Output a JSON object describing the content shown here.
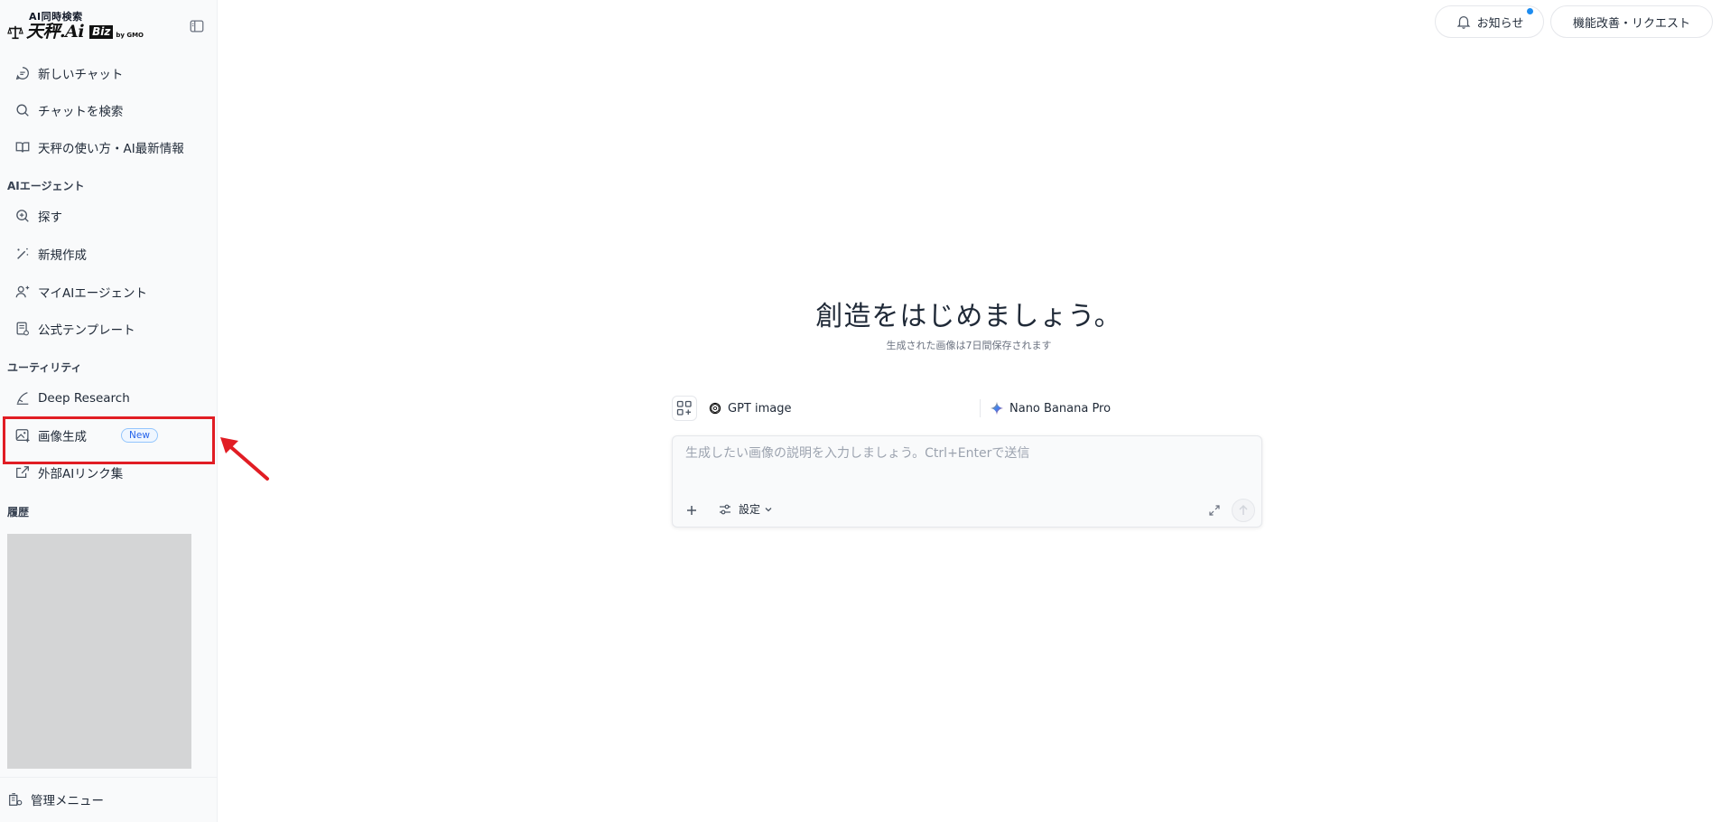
{
  "logo": {
    "subtitle": "AI同時検索",
    "brand": "天秤.Ai",
    "biz": "Biz",
    "by": "by GMO"
  },
  "sidebar": {
    "top_items": [
      {
        "label": "新しいチャット",
        "icon": "chat-bubble-icon"
      },
      {
        "label": "チャットを検索",
        "icon": "search-icon"
      },
      {
        "label": "天秤の使い方・AI最新情報",
        "icon": "book-icon"
      }
    ],
    "agents_section": "AIエージェント",
    "agent_items": [
      {
        "label": "探す",
        "icon": "zoom-plus-icon"
      },
      {
        "label": "新規作成",
        "icon": "magic-wand-icon"
      },
      {
        "label": "マイAIエージェント",
        "icon": "user-plus-icon"
      },
      {
        "label": "公式テンプレート",
        "icon": "template-icon"
      }
    ],
    "utility_section": "ユーティリティ",
    "utility_items": [
      {
        "label": "Deep Research",
        "icon": "research-icon"
      },
      {
        "label": "画像生成",
        "icon": "image-gen-icon",
        "badge": "New"
      },
      {
        "label": "外部AIリンク集",
        "icon": "external-link-icon"
      }
    ],
    "history_section": "履歴",
    "admin_menu": "管理メニュー"
  },
  "header": {
    "notice": "お知らせ",
    "request": "機能改善・リクエスト"
  },
  "main": {
    "title": "創造をはじめましょう。",
    "subtitle": "生成された画像は7日間保存されます",
    "models": [
      {
        "label": "GPT image",
        "icon": "openai-icon"
      },
      {
        "label": "Nano Banana Pro",
        "icon": "gemini-sparkle-icon"
      }
    ],
    "composer": {
      "placeholder": "生成したい画像の説明を入力しましょう。Ctrl+Enterで送信",
      "settings_label": "設定"
    }
  },
  "colors": {
    "highlight": "#e11d24",
    "accent_blue": "#1d8cf0",
    "badge_blue": "#2563eb"
  }
}
